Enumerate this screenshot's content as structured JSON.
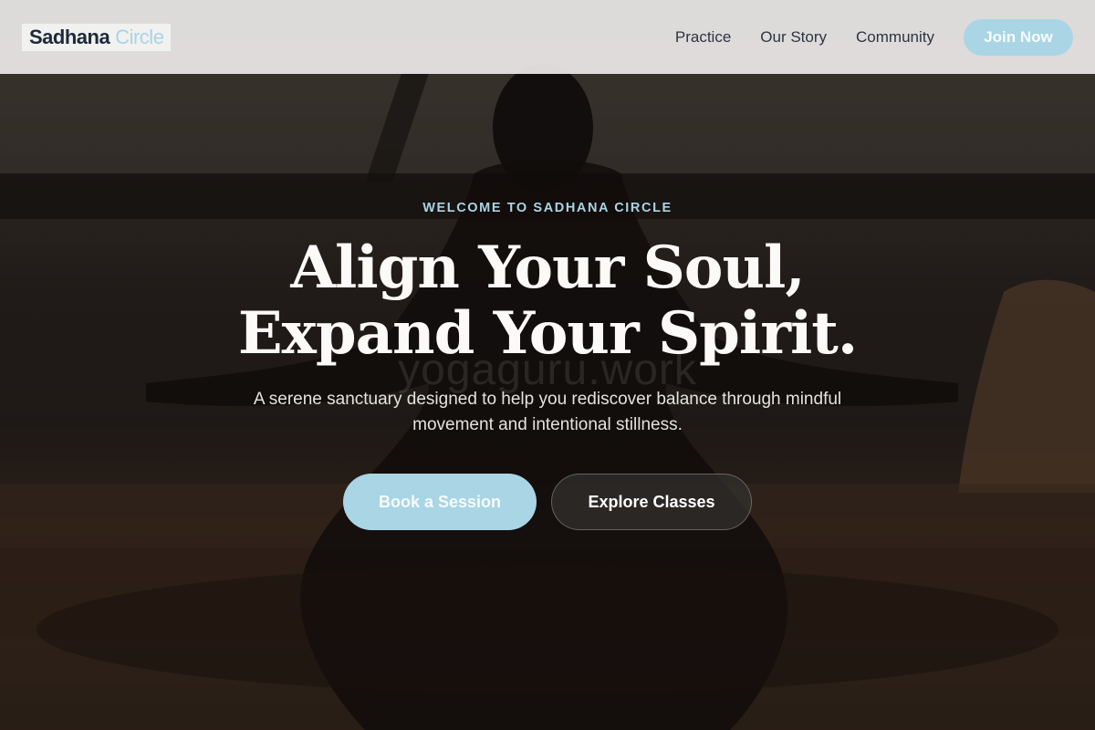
{
  "header": {
    "logo_primary": "Sadhana",
    "logo_accent": "Circle",
    "nav": [
      "Practice",
      "Our Story",
      "Community"
    ],
    "cta": "Join Now"
  },
  "hero": {
    "eyebrow": "WELCOME TO SADHANA CIRCLE",
    "title_line1": "Align Your Soul,",
    "title_line2": "Expand Your Spirit.",
    "watermark": "yogaguru.work",
    "subtitle": "A serene sanctuary designed to help you rediscover balance through mindful movement and intentional stillness.",
    "primary_button": "Book a Session",
    "secondary_button": "Explore Classes",
    "background_image": "person-meditating-silhouette"
  },
  "colors": {
    "accent": "#a9d5e5",
    "header_bg": "#e9e7e5",
    "heading_text": "#fbfaf8",
    "nav_text": "#2e3440"
  }
}
